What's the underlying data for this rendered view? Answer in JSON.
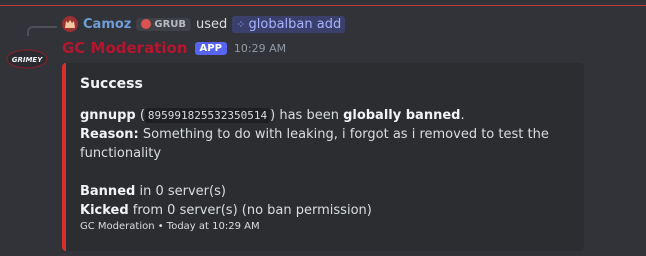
{
  "reply": {
    "username": "Camoz",
    "guild_tag": "GRUB",
    "used_text": "used",
    "command": "globalban add"
  },
  "message": {
    "author": "GC Moderation",
    "badge": "APP",
    "timestamp": "10:29 AM",
    "avatar_text": "GRIMEY"
  },
  "embed": {
    "color": "#da2d2d",
    "title": "Success",
    "line1": {
      "user": "gnnupp",
      "open_paren": " (",
      "user_id": "895991825532350514",
      "close_paren": ") has been ",
      "action": "globally banned",
      "end": "."
    },
    "reason_label": "Reason:",
    "reason_text": " Something to do with leaking, i forgot as i removed to test the functionality",
    "banned_label": "Banned",
    "banned_text": " in 0 server(s)",
    "kicked_label": "Kicked",
    "kicked_text": " from 0 server(s) (no ban permission)",
    "footer": "GC Moderation • Today at 10:29 AM"
  }
}
